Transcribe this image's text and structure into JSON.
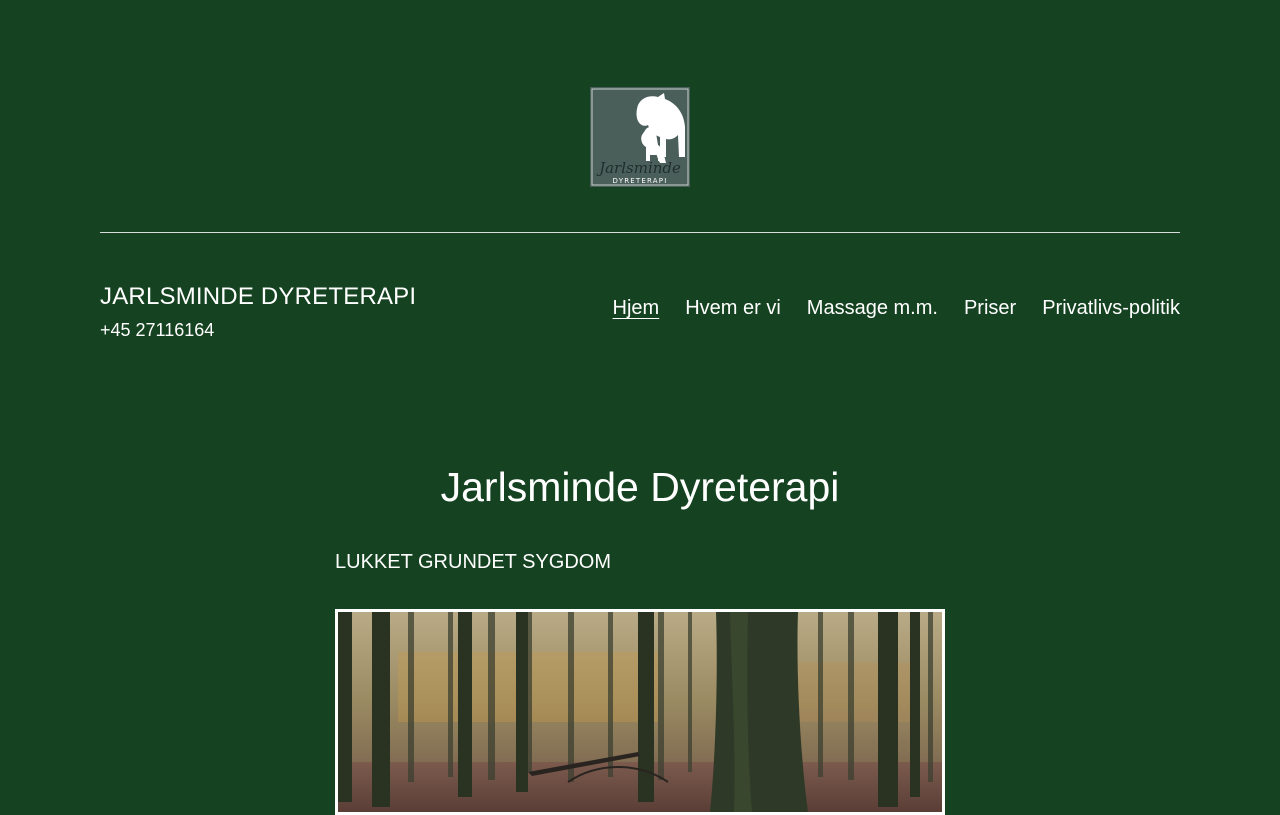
{
  "header": {
    "logo": {
      "icon": "horse-dog-logo",
      "brand_script": "Jarlsminde",
      "brand_caps": "DYRETERAPI",
      "background_color": "#4a5e5a"
    },
    "site_title": "JARLSMINDE DYRETERAPI",
    "site_description": "+45 27116164"
  },
  "nav": {
    "items": [
      {
        "label": "Hjem",
        "current": true
      },
      {
        "label": "Hvem er vi",
        "current": false
      },
      {
        "label": "Massage m.m.",
        "current": false
      },
      {
        "label": "Priser",
        "current": false
      },
      {
        "label": "Privatlivs-politik",
        "current": false
      }
    ]
  },
  "main": {
    "title": "Jarlsminde Dyreterapi",
    "notice": "LUKKET GRUNDET SYGDOM",
    "image": {
      "subject": "forest-photo"
    }
  },
  "colors": {
    "background": "#154220",
    "text": "#ffffff"
  }
}
